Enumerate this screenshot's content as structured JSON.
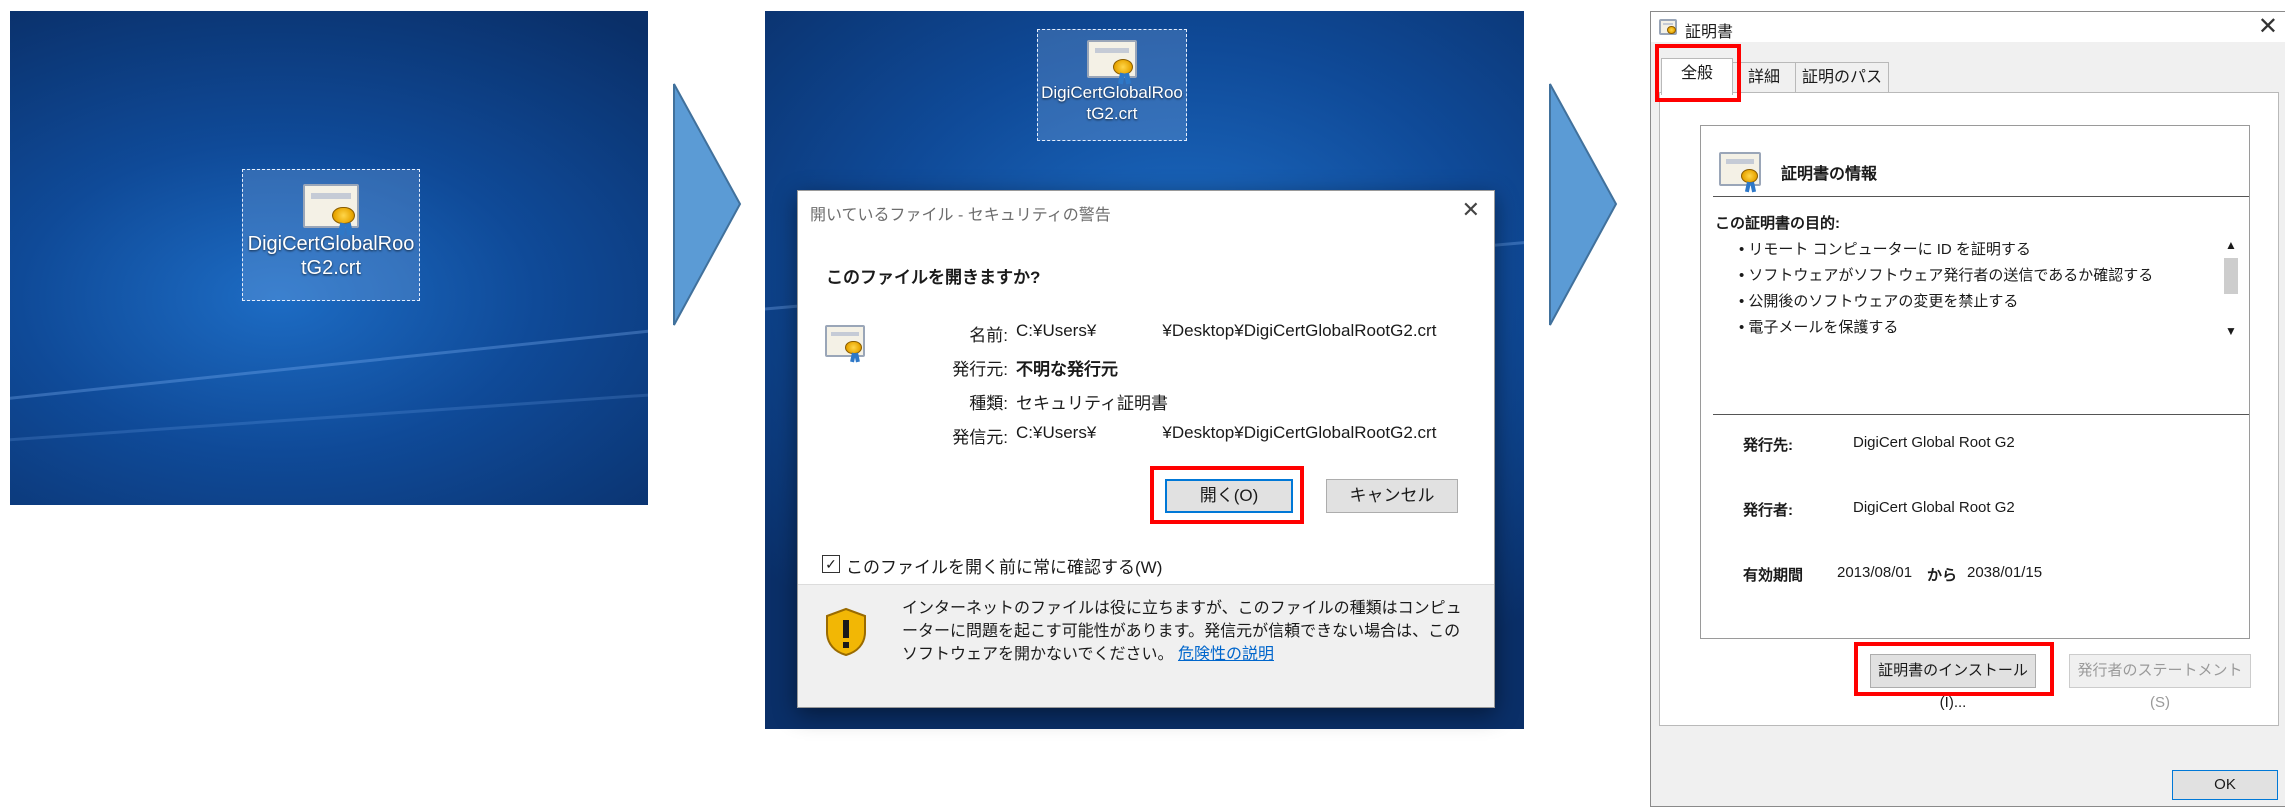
{
  "desktop1": {
    "icon_label_line1": "DigiCertGlobalRoo",
    "icon_label_line2": "tG2.crt"
  },
  "desktop2": {
    "icon_label_line1": "DigiCertGlobalRoo",
    "icon_label_line2": "tG2.crt"
  },
  "security_dialog": {
    "title": "開いているファイル - セキュリティの警告",
    "close_label": "✕",
    "question": "このファイルを開きますか?",
    "fields": [
      {
        "key": "名前:",
        "value": "C:¥Users¥              ¥Desktop¥DigiCertGlobalRootG2.crt"
      },
      {
        "key": "発行元:",
        "value": "不明な発行元"
      },
      {
        "key": "種類:",
        "value": "セキュリティ証明書"
      },
      {
        "key": "発信元:",
        "value": "C:¥Users¥              ¥Desktop¥DigiCertGlobalRootG2.crt"
      }
    ],
    "open_button": "開く(O)",
    "cancel_button": "キャンセル",
    "always_ask_label": "このファイルを開く前に常に確認する(W)",
    "always_ask_checked": true,
    "warning_text": "インターネットのファイルは役に立ちますが、このファイルの種類はコンピューターに問題を起こす可能性があります。発信元が信頼できない場合は、このソフトウェアを開かないでください。",
    "warning_link": "危険性の説明"
  },
  "certificate_window": {
    "title": "証明書",
    "close_label": "✕",
    "tabs": [
      "全般",
      "詳細",
      "証明のパス"
    ],
    "active_tab": "全般",
    "info_heading": "証明書の情報",
    "purpose_heading": "この証明書の目的:",
    "purposes": [
      "• リモート コンピューターに ID を証明する",
      "• ソフトウェアがソフトウェア発行者の送信であるか確認する",
      "• 公開後のソフトウェアの変更を禁止する",
      "• 電子メールを保護する"
    ],
    "issued_to_label": "発行先:",
    "issued_to_value": "DigiCert Global Root G2",
    "issued_by_label": "発行者:",
    "issued_by_value": "DigiCert Global Root G2",
    "validity_label": "有効期間",
    "valid_from": "2013/08/01",
    "validity_from_word": "から",
    "valid_to": "2038/01/15",
    "install_button": "証明書のインストール(I)...",
    "issuer_statement_button": "発行者のステートメント(S)",
    "ok_button": "OK"
  },
  "colors": {
    "highlight": "#ff0000",
    "arrow": "#5b9bd5",
    "desktop": "#0f4a98",
    "link": "#0066cc"
  }
}
